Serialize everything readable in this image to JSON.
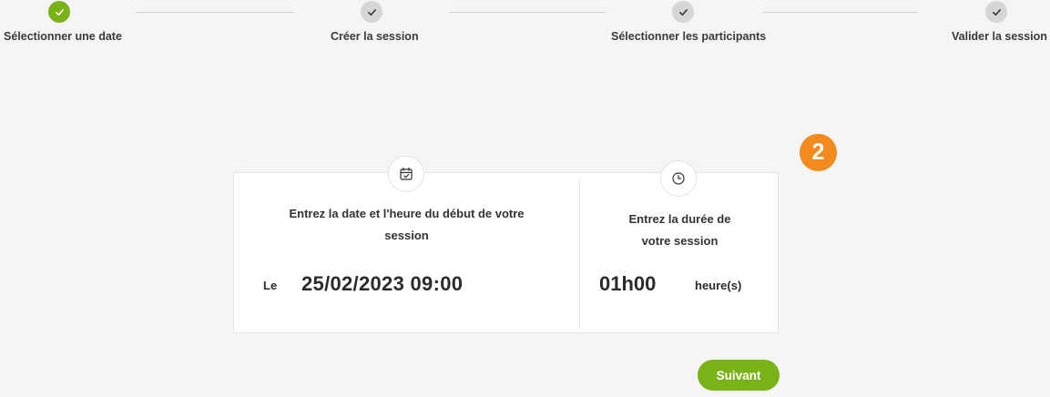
{
  "stepper": {
    "steps": [
      {
        "label": "Sélectionner une date",
        "status": "done"
      },
      {
        "label": "Créer la session",
        "status": "todo"
      },
      {
        "label": "Sélectionner les participants",
        "status": "todo"
      },
      {
        "label": "Valider la session",
        "status": "todo"
      }
    ],
    "done_color": "#7ab317",
    "todo_color": "#d6d6d6"
  },
  "badge": {
    "number": "2",
    "color": "#f28a1e"
  },
  "date_panel": {
    "icon": "calendar-check-icon",
    "instruction_line1": "Entrez la date et l'heure du début de votre",
    "instruction_line2": "session",
    "prefix": "Le",
    "value": "25/02/2023 09:00"
  },
  "duration_panel": {
    "icon": "clock-icon",
    "instruction_line1": "Entrez la durée de",
    "instruction_line2": "votre session",
    "value": "01h00",
    "unit": "heure(s)"
  },
  "next_button": {
    "label": "Suivant",
    "color": "#7ab317"
  }
}
